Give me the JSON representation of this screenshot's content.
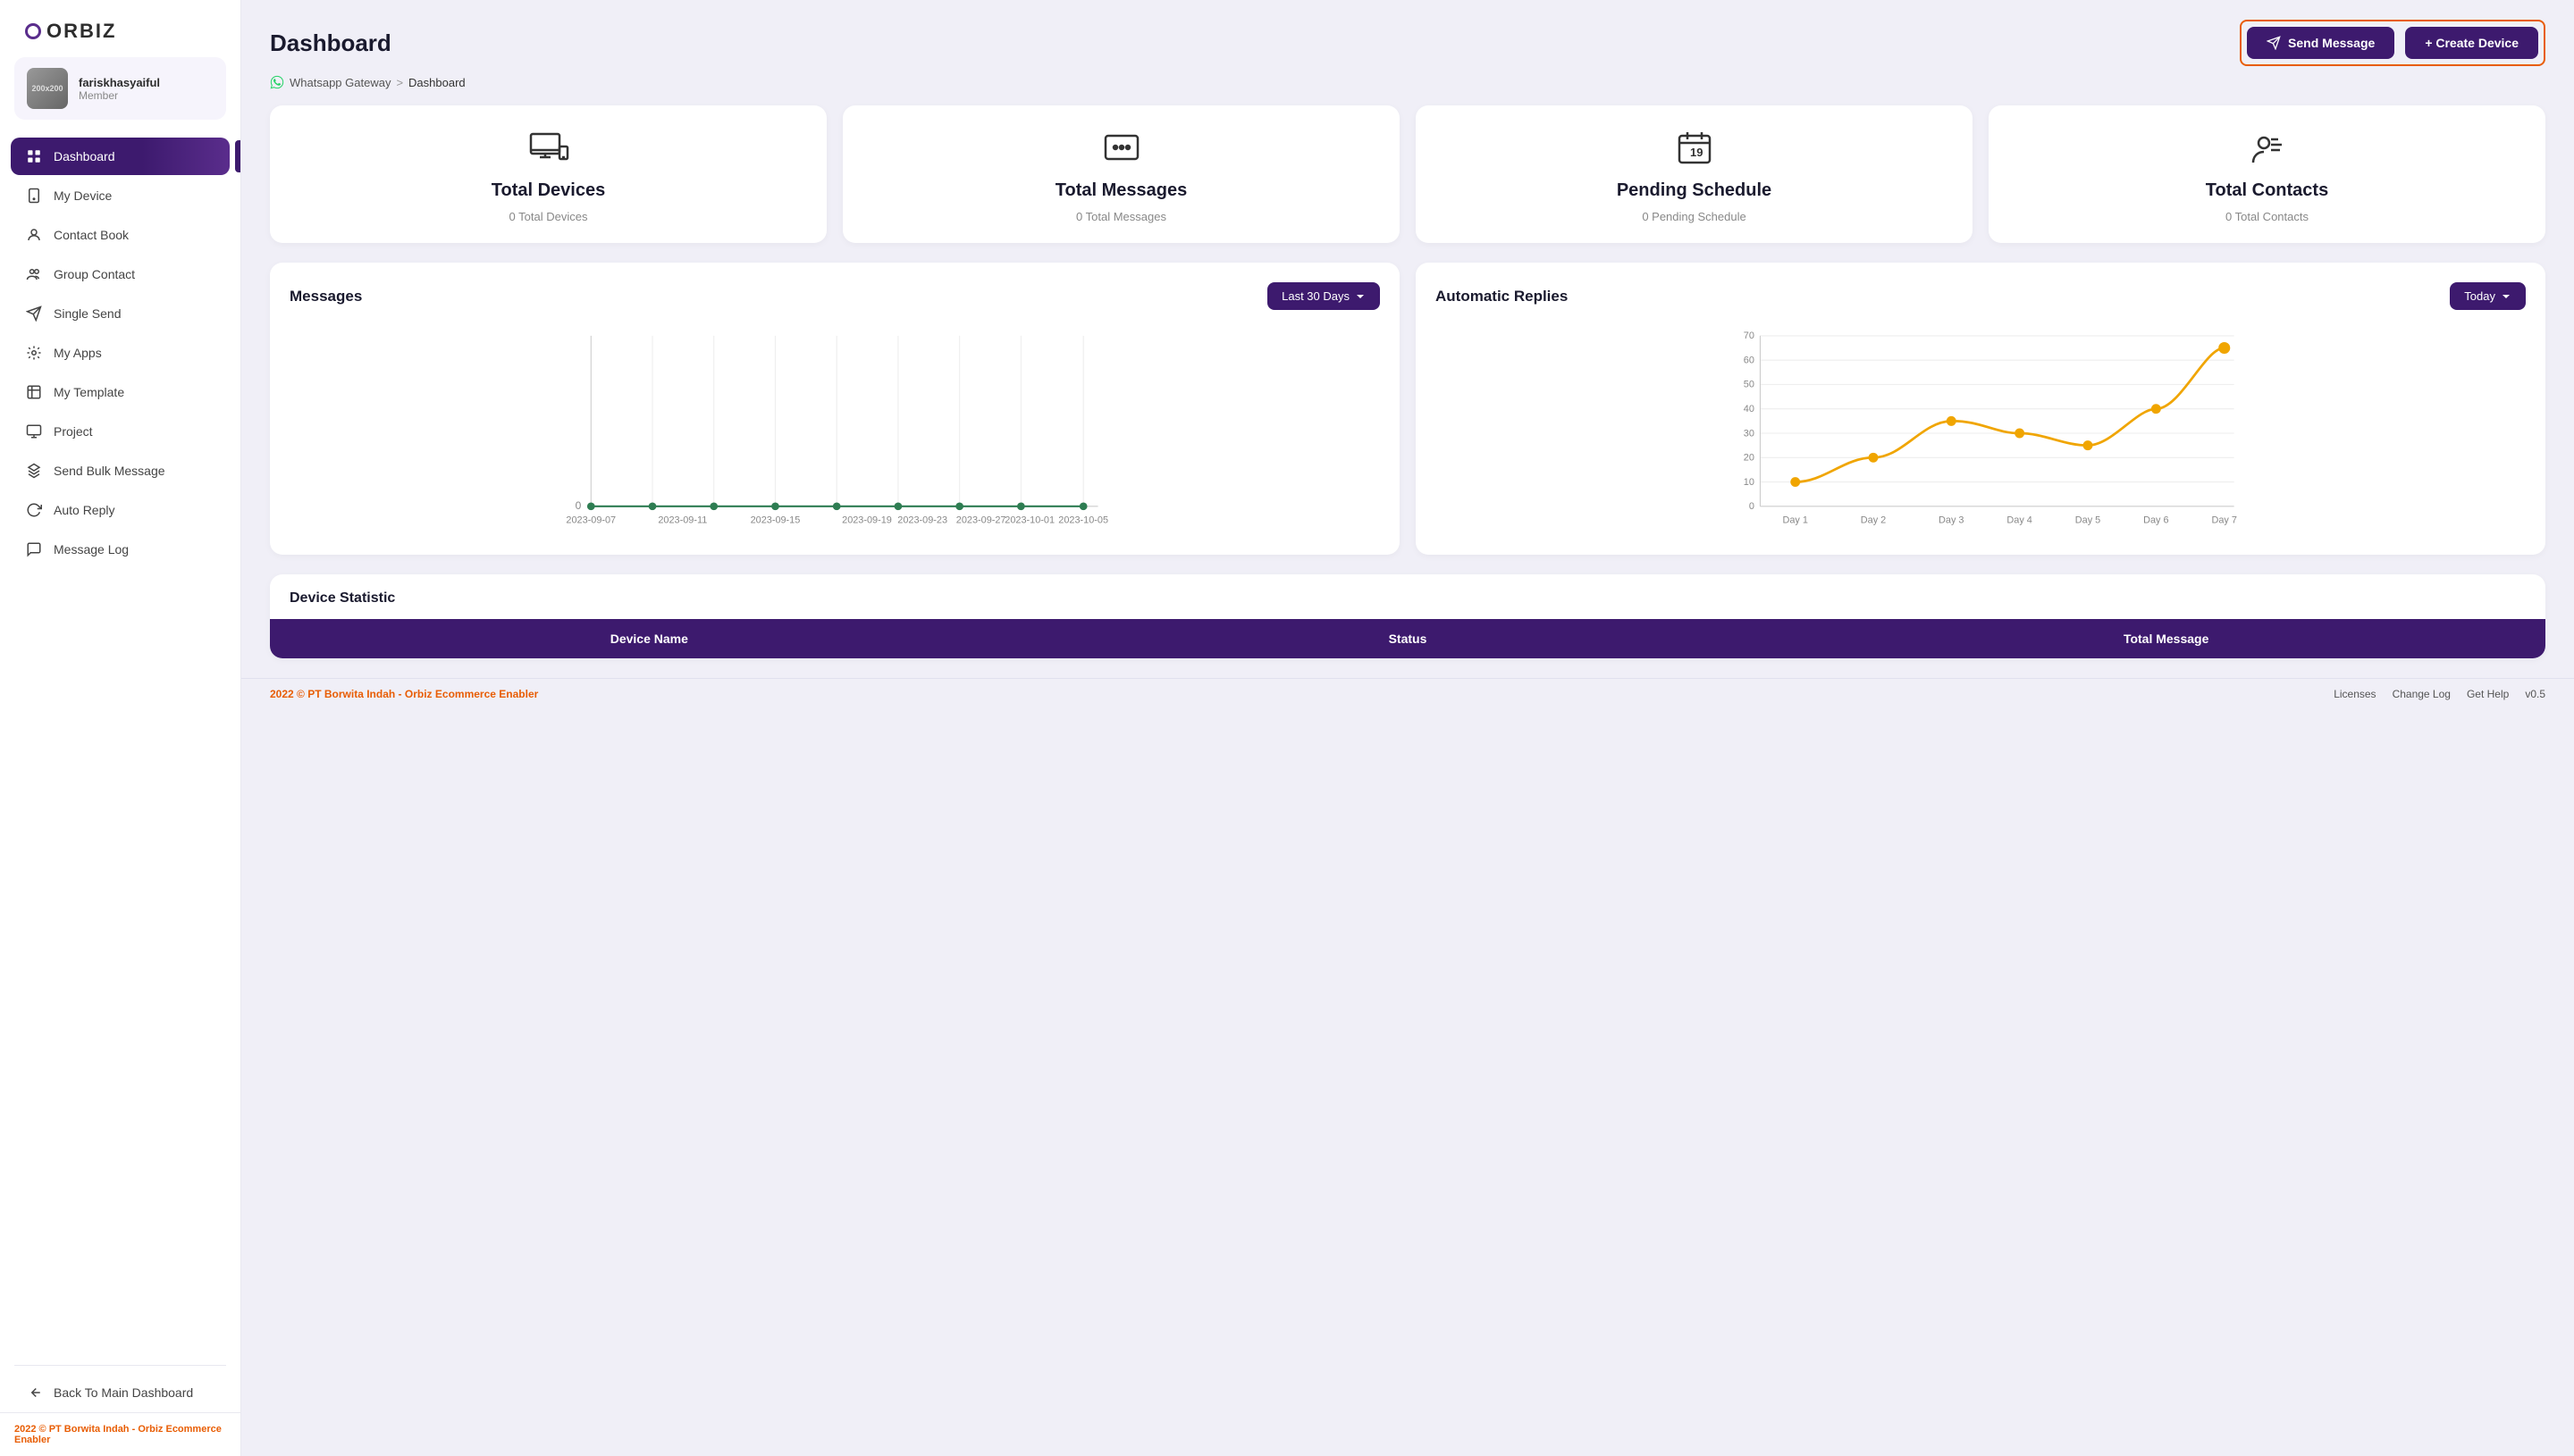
{
  "logo": {
    "text": "ORBIZ"
  },
  "user": {
    "name": "fariskhasyaiful",
    "role": "Member",
    "avatar_label": "200x200"
  },
  "nav": {
    "items": [
      {
        "id": "dashboard",
        "label": "Dashboard",
        "icon": "📊",
        "active": true
      },
      {
        "id": "my-device",
        "label": "My Device",
        "icon": "📱"
      },
      {
        "id": "contact-book",
        "label": "Contact Book",
        "icon": "👤"
      },
      {
        "id": "group-contact",
        "label": "Group Contact",
        "icon": "👥"
      },
      {
        "id": "single-send",
        "label": "Single Send",
        "icon": "✉️"
      },
      {
        "id": "my-apps",
        "label": "My Apps",
        "icon": "🔗"
      },
      {
        "id": "my-template",
        "label": "My Template",
        "icon": "📋"
      },
      {
        "id": "project",
        "label": "Project",
        "icon": "📁"
      },
      {
        "id": "send-bulk-message",
        "label": "Send Bulk Message",
        "icon": "🚀"
      },
      {
        "id": "auto-reply",
        "label": "Auto Reply",
        "icon": "🔄"
      },
      {
        "id": "message-log",
        "label": "Message Log",
        "icon": "💬"
      }
    ],
    "back_label": "Back To Main Dashboard"
  },
  "header": {
    "page_title": "Dashboard",
    "send_button": "Send Message",
    "create_button": "+ Create Device"
  },
  "breadcrumb": {
    "gateway": "Whatsapp Gateway",
    "separator": ">",
    "current": "Dashboard"
  },
  "stats": [
    {
      "id": "total-devices",
      "title": "Total Devices",
      "sub": "0 Total Devices",
      "icon": "🖥️"
    },
    {
      "id": "total-messages",
      "title": "Total Messages",
      "sub": "0 Total Messages",
      "icon": "💬"
    },
    {
      "id": "pending-schedule",
      "title": "Pending Schedule",
      "sub": "0 Pending Schedule",
      "icon": "📅"
    },
    {
      "id": "total-contacts",
      "title": "Total Contacts",
      "sub": "0 Total Contacts",
      "icon": "👤"
    }
  ],
  "messages_chart": {
    "title": "Messages",
    "dropdown_label": "Last 30 Days",
    "x_labels": [
      "2023-09-07",
      "2023-09-11",
      "2023-09-15",
      "2023-09-19",
      "2023-09-23",
      "2023-09-27",
      "2023-10-01",
      "2023-10-05"
    ],
    "y_start": "0"
  },
  "auto_replies_chart": {
    "title": "Automatic Replies",
    "dropdown_label": "Today",
    "x_labels": [
      "Day 1",
      "Day 2",
      "Day 3",
      "Day 4",
      "Day 5",
      "Day 6",
      "Day 7"
    ],
    "y_labels": [
      "0",
      "10",
      "20",
      "30",
      "40",
      "50",
      "60",
      "70"
    ],
    "data_points": [
      10,
      20,
      35,
      30,
      25,
      40,
      65
    ]
  },
  "device_table": {
    "title": "Device Statistic",
    "columns": [
      "Device Name",
      "Status",
      "Total Message"
    ]
  },
  "footer": {
    "copyright": "2022 © PT Borwita Indah -",
    "brand": "Orbiz Ecommerce Enabler",
    "links": [
      "Licenses",
      "Change Log",
      "Get Help",
      "v0.5"
    ]
  }
}
